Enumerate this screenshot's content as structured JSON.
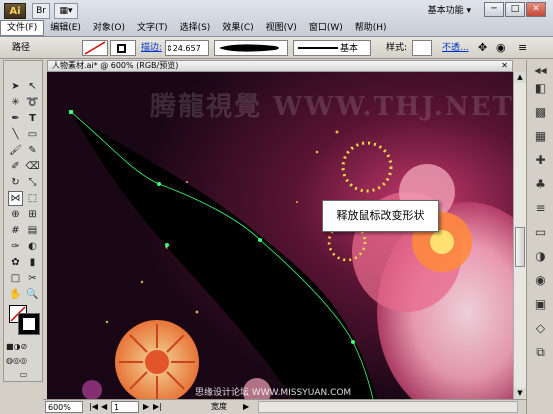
{
  "app": {
    "logo_text": "Ai",
    "workspace_label": "基本功能",
    "workspace_arrow": "▾",
    "window_buttons": [
      "─",
      "□",
      "✕"
    ]
  },
  "menu": [
    {
      "label": "文件(F)",
      "active": true
    },
    {
      "label": "编辑(E)"
    },
    {
      "label": "对象(O)"
    },
    {
      "label": "文字(T)"
    },
    {
      "label": "选择(S)"
    },
    {
      "label": "效果(C)"
    },
    {
      "label": "视图(V)"
    },
    {
      "label": "窗口(W)"
    },
    {
      "label": "帮助(H)"
    }
  ],
  "controlbar": {
    "selection_label": "路径",
    "stroke_label": "描边:",
    "stroke_value": "24.657",
    "brush_profile_label": "基本",
    "style_label": "样式:",
    "opacity_link": "不透..."
  },
  "document": {
    "tab_title": "人物素材.ai* @ 600% (RGB/预览)",
    "callout_text": "释放鼠标改变形状",
    "watermark_text": "腾龍視覺 WWW.THJ.NET",
    "watermark_footer": "思缘设计论坛 WWW.MISSYUAN.COM"
  },
  "statusbar": {
    "zoom_value": "600%",
    "page_value": "1",
    "tool_status": "宽度"
  },
  "icons": {
    "selection": "selection-arrow-icon",
    "direct_selection": "direct-selection-icon",
    "magic_wand": "magic-wand-icon",
    "lasso": "lasso-icon",
    "pen": "pen-icon",
    "type": "type-icon",
    "line": "line-segment-icon",
    "rectangle": "rectangle-icon",
    "paintbrush": "paintbrush-icon",
    "pencil": "pencil-icon",
    "blob_brush": "blob-brush-icon",
    "eraser": "eraser-icon",
    "rotate": "rotate-icon",
    "scale": "scale-icon",
    "width": "width-tool-icon",
    "free_transform": "free-transform-icon",
    "shape_builder": "shape-builder-icon",
    "perspective": "perspective-grid-icon",
    "mesh": "mesh-icon",
    "gradient": "gradient-icon",
    "eyedropper": "eyedropper-icon",
    "blend": "blend-icon",
    "symbol_sprayer": "symbol-sprayer-icon",
    "column_graph": "column-graph-icon",
    "artboard": "artboard-icon",
    "slice": "slice-icon",
    "hand": "hand-icon",
    "zoom": "zoom-icon"
  },
  "colors": {
    "path_stroke": "#39ff7a",
    "canvas_bg": "#1a0716",
    "accent_link": "#0033cc"
  }
}
